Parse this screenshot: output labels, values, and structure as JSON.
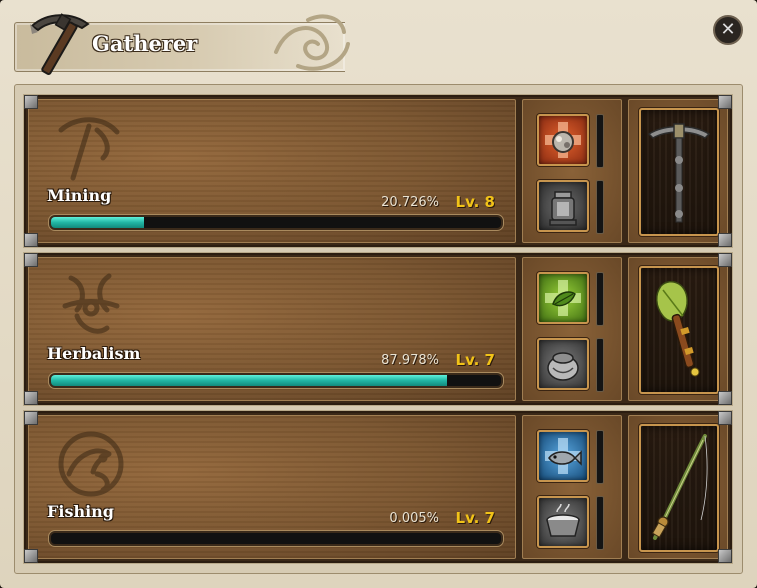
{
  "window": {
    "title": "Gatherer",
    "close_icon": "close-icon"
  },
  "skills": [
    {
      "name": "Mining",
      "percent_text": "20.726%",
      "level_text": "Lv. 8",
      "progress": 0.20726,
      "emblem_icon": "pickaxe-emblem-icon",
      "slot_icons": [
        "ore-boost-icon",
        "lantern-icon"
      ],
      "tool_icon": "pickaxe-tool-icon",
      "slot_top_color": "#b8431e"
    },
    {
      "name": "Herbalism",
      "percent_text": "87.978%",
      "level_text": "Lv. 7",
      "progress": 0.87978,
      "emblem_icon": "herb-emblem-icon",
      "slot_icons": [
        "herb-boost-icon",
        "seed-pouch-icon"
      ],
      "tool_icon": "sickle-tool-icon",
      "slot_top_color": "#6aa21f"
    },
    {
      "name": "Fishing",
      "percent_text": "0.005%",
      "level_text": "Lv. 7",
      "progress": 5e-05,
      "emblem_icon": "fish-emblem-icon",
      "slot_icons": [
        "fish-boost-icon",
        "cooking-pot-icon"
      ],
      "tool_icon": "fishing-rod-tool-icon",
      "slot_top_color": "#2c6da3"
    }
  ],
  "colors": {
    "xp_bar": "#22b6a4",
    "level_text": "#f2c318",
    "slot_border": "#c7954e"
  }
}
